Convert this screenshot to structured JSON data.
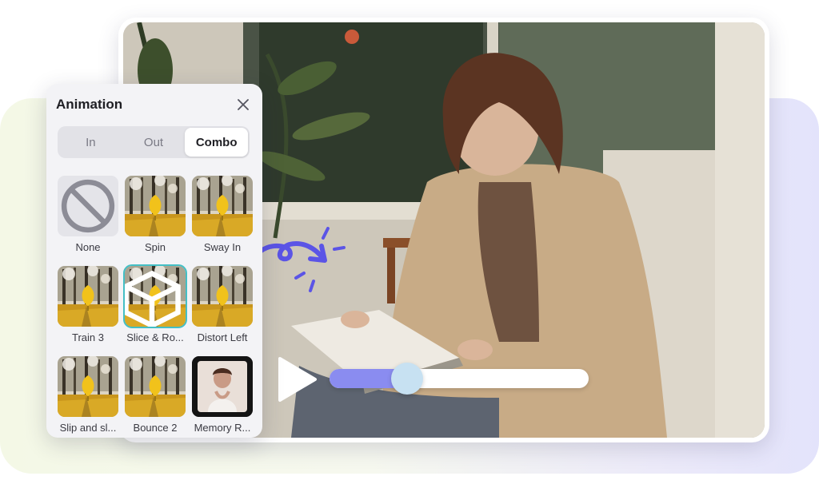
{
  "panel": {
    "title": "Animation",
    "tabs": [
      {
        "label": "In",
        "active": false
      },
      {
        "label": "Out",
        "active": false
      },
      {
        "label": "Combo",
        "active": true
      }
    ],
    "items": [
      {
        "label": "None",
        "thumb": "none-icon"
      },
      {
        "label": "Spin",
        "thumb": "tree-leaf"
      },
      {
        "label": "Sway In",
        "thumb": "tree-leaf"
      },
      {
        "label": "Train 3",
        "thumb": "tree-leaf"
      },
      {
        "label": "Slice & Ro...",
        "thumb": "tree-leaf",
        "selected": true,
        "badge": "cube-icon"
      },
      {
        "label": "Distort Left",
        "thumb": "tree-leaf"
      },
      {
        "label": "Slip and sl...",
        "thumb": "tree-leaf"
      },
      {
        "label": "Bounce 2",
        "thumb": "tree-leaf"
      },
      {
        "label": "Memory R...",
        "thumb": "photo-portrait"
      }
    ]
  },
  "player": {
    "progress": 0.3
  },
  "colors": {
    "accent": "#8a8cf0",
    "knob": "#c7e1f2",
    "selected_outline": "#44bfc5",
    "doodle": "#5b54e6"
  }
}
